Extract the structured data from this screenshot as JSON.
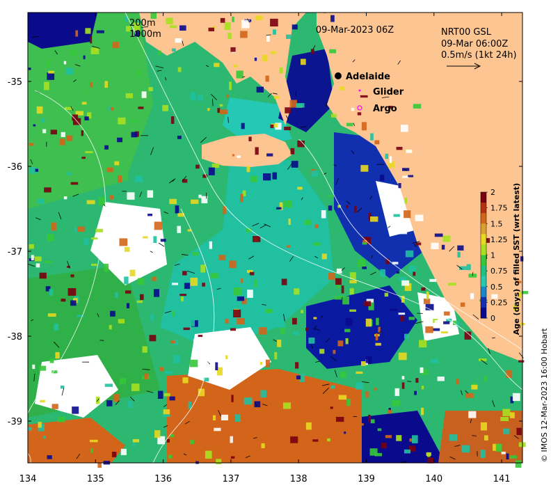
{
  "map": {
    "header_date": "09-Mar-2023 06Z",
    "product": "NRT00 GSL",
    "vector_time": "09-Mar 06:00Z",
    "vector_scale": "0.5m/s (1kt 24h)",
    "isobath_labels": [
      "200m",
      "1000m"
    ],
    "credit": "© IMOS 12-Mar-2023 16:00 Hobart",
    "x_ticks": [
      "134",
      "135",
      "136",
      "137",
      "138",
      "139",
      "140",
      "141"
    ],
    "y_ticks": [
      "-35",
      "-36",
      "-37",
      "-38",
      "-39"
    ],
    "legend": [
      {
        "label": "Adelaide",
        "symbol": "dot",
        "color": "#000000"
      },
      {
        "label": "Glider",
        "symbol": "small-dot",
        "color": "#ff00ff"
      },
      {
        "label": "Argo",
        "symbol": "ring",
        "color": "#ff00ff"
      }
    ],
    "colorbar": {
      "title": "Age (days) of filled SST (wrt latest)",
      "ticks": [
        "2",
        "1.75",
        "1.5",
        "1.25",
        "1",
        "0.75",
        "0.5",
        "0.25",
        "0"
      ],
      "colors": [
        "#7a0010",
        "#b33010",
        "#d2651a",
        "#dca030",
        "#e8d820",
        "#a8e020",
        "#36c83a",
        "#20c080",
        "#28c8b0",
        "#1a86c8",
        "#1430b0",
        "#0a0a8c"
      ]
    },
    "land_color": "#fdc592"
  }
}
